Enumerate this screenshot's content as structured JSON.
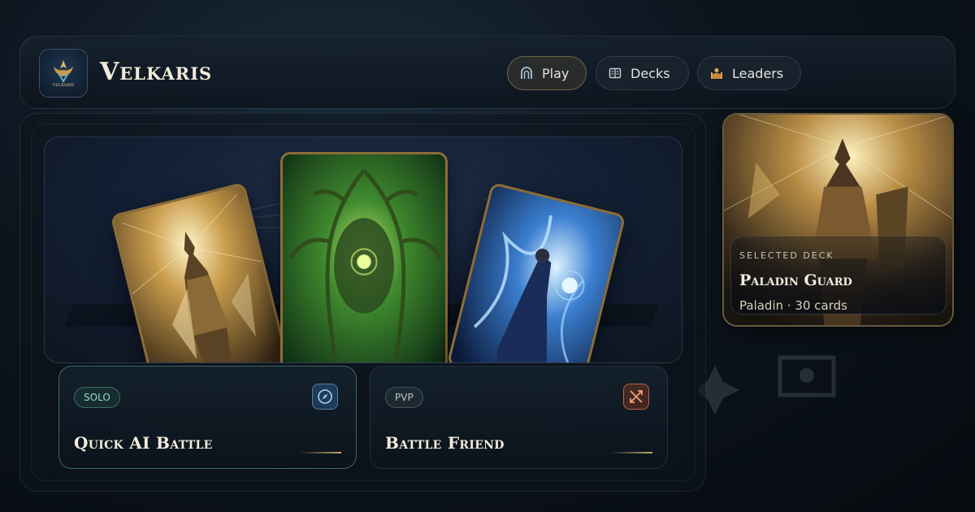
{
  "header": {
    "brand": "Velkaris",
    "logo_text": "VELKARIS"
  },
  "nav": [
    {
      "label": "Play",
      "icon": "arch-icon",
      "active": true
    },
    {
      "label": "Decks",
      "icon": "book-icon",
      "active": false
    },
    {
      "label": "Leaders",
      "icon": "leader-icon",
      "active": false
    }
  ],
  "showcase": {
    "cards": [
      {
        "name": "paladin-card",
        "theme": "gold"
      },
      {
        "name": "treant-card",
        "theme": "green"
      },
      {
        "name": "sorceress-card",
        "theme": "blue"
      }
    ]
  },
  "modes": [
    {
      "badge": "SOLO",
      "title": "Quick AI Battle",
      "icon": "compass-icon"
    },
    {
      "badge": "PVP",
      "title": "Battle Friend",
      "icon": "swords-icon"
    }
  ],
  "deck": {
    "kicker": "SELECTED DECK",
    "name": "Paladin Guard",
    "meta": "Paladin · 30 cards"
  },
  "colors": {
    "accent_gold": "#c9a86a",
    "solo_teal": "#98d7c8",
    "pvp_orange": "#e6825a",
    "background": "#0c141d"
  }
}
